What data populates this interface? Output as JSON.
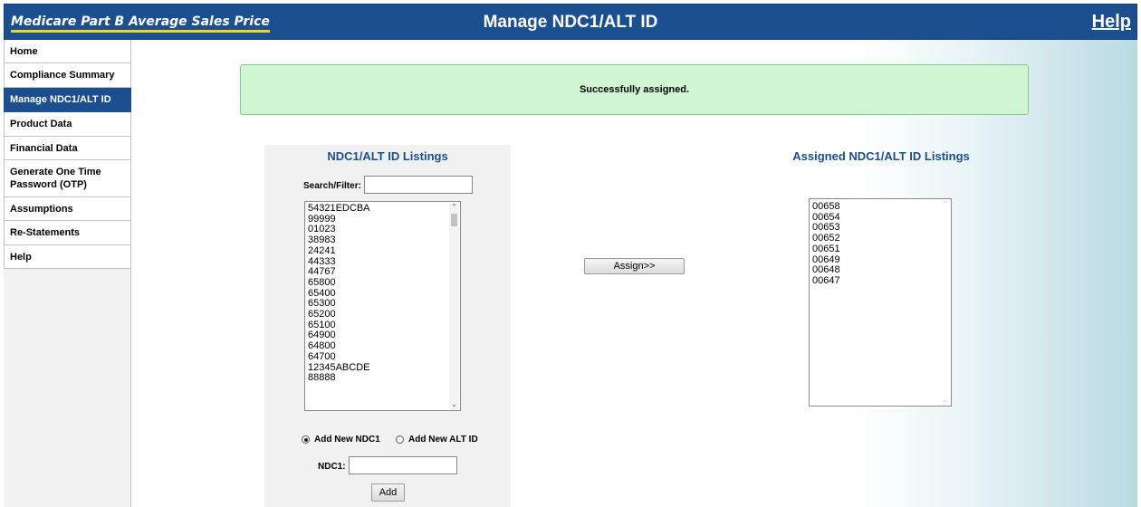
{
  "header": {
    "brand": "Medicare Part B Average Sales Price",
    "title": "Manage NDC1/ALT ID",
    "help_link": "Help"
  },
  "sidebar": {
    "items": [
      {
        "label": "Home",
        "active": false
      },
      {
        "label": "Compliance Summary",
        "active": false
      },
      {
        "label": "Manage NDC1/ALT ID",
        "active": true
      },
      {
        "label": "Product Data",
        "active": false
      },
      {
        "label": "Financial Data",
        "active": false
      },
      {
        "label": "Generate One Time Password (OTP)",
        "active": false
      },
      {
        "label": "Assumptions",
        "active": false
      },
      {
        "label": "Re-Statements",
        "active": false
      },
      {
        "label": "Help",
        "active": false
      }
    ]
  },
  "message": {
    "text": "Successfully assigned.",
    "color": "#cff5d3"
  },
  "listings": {
    "heading": "NDC1/ALT ID Listings",
    "search_label": "Search/Filter:",
    "search_value": "",
    "options": [
      "54321EDCBA",
      "99999",
      "01023",
      "38983",
      "24241",
      "44333",
      "44767",
      "65800",
      "65400",
      "65300",
      "65200",
      "65100",
      "64900",
      "64800",
      "64700",
      "12345ABCDE",
      "88888"
    ],
    "radio_ndc1": "Add New NDC1",
    "radio_altid": "Add New ALT ID",
    "selected_radio": "Add New NDC1",
    "ndc1_label": "NDC1:",
    "ndc1_value": "",
    "add_button": "Add"
  },
  "assign_button": "Assign>>",
  "assigned": {
    "heading": "Assigned NDC1/ALT ID Listings",
    "options": [
      "00658",
      "00654",
      "00653",
      "00652",
      "00651",
      "00649",
      "00648",
      "00647"
    ]
  },
  "colors": {
    "header_bg": "#1b4f8f",
    "brand_underline": "#f2d51f",
    "heading_text": "#1b4f8f"
  }
}
